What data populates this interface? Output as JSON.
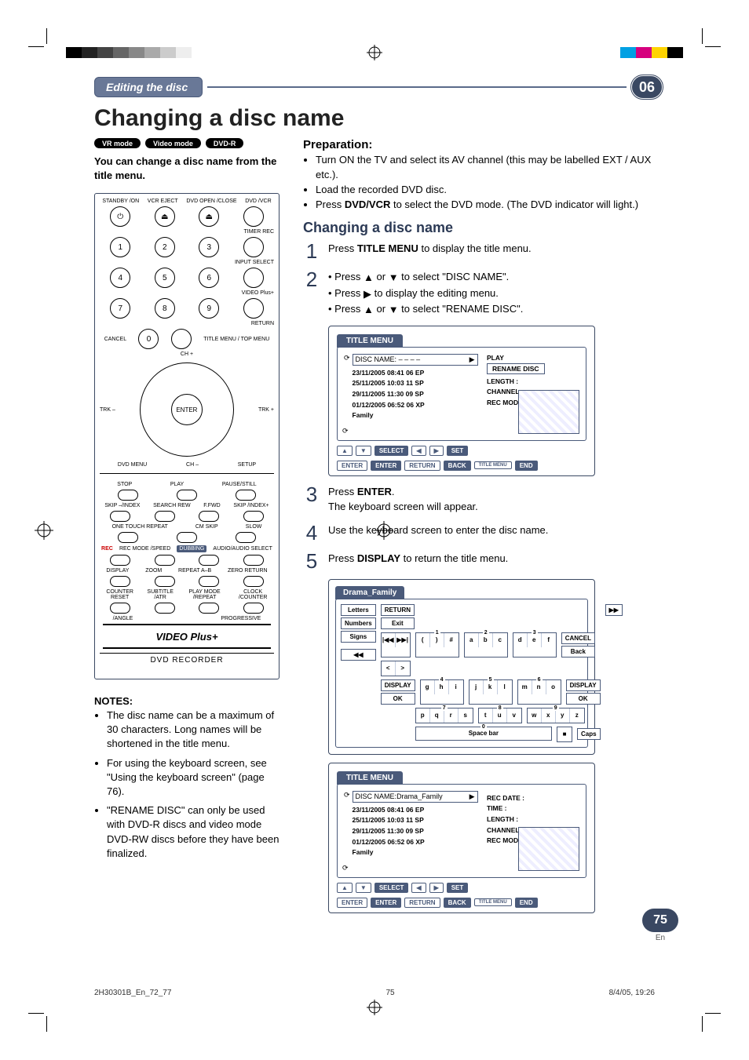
{
  "print_marks": {
    "footer_file": "2H30301B_En_72_77",
    "footer_page": "75",
    "footer_date": "8/4/05, 19:26"
  },
  "header": {
    "section": "Editing the disc",
    "chapter": "06"
  },
  "title": "Changing a disc name",
  "pills": [
    "VR mode",
    "Video mode",
    "DVD-R"
  ],
  "intro": "You can change a disc name from the title menu.",
  "remote": {
    "standby": "STANDBY\n/ON",
    "vcr_eject": "VCR\nEJECT",
    "dvd_open": "DVD\nOPEN\n/CLOSE",
    "dvd_vcr": "DVD\n/VCR",
    "timer_rec": "TIMER REC",
    "input_select": "INPUT SELECT",
    "video_plus": "VIDEO Plus+",
    "return": "RETURN",
    "cancel": "CANCEL",
    "title_menu": "TITLE MENU\n/ TOP MENU",
    "ch_plus": "CH +",
    "ch_minus": "CH –",
    "trk_minus": "TRK\n–",
    "trk_plus": "TRK\n+",
    "enter": "ENTER",
    "dvd_menu": "DVD\nMENU",
    "setup": "SETUP",
    "stop": "STOP",
    "play": "PLAY",
    "pause": "PAUSE/STILL",
    "skip_minus": "SKIP\n–/INDEX",
    "search_rew": "SEARCH REW",
    "search_fwd": "F.FWD",
    "skip_plus": "SKIP\n/INDEX+",
    "one_touch": "ONE TOUCH\nREPEAT",
    "cm_skip": "CM SKIP",
    "slow": "SLOW",
    "rec": "REC",
    "rec_mode": "REC MODE\n/SPEED",
    "dubbing": "DUBBING",
    "audio_sel": "AUDIO/AUDIO\nSELECT",
    "display": "DISPLAY",
    "zoom": "ZOOM",
    "repeat_ab": "REPEAT A–B",
    "zero_return": "ZERO RETURN",
    "counter_reset": "COUNTER\nRESET",
    "subtitle": "SUBTITLE\n/ATR",
    "play_mode": "PLAY MODE\n/REPEAT",
    "clock": "CLOCK\n/COUNTER",
    "angle": "/ANGLE",
    "progressive": "PROGRESSIVE",
    "brand": "VIDEO Plus+",
    "device": "DVD RECORDER"
  },
  "notes_heading": "NOTES:",
  "notes": [
    "The disc name can be a maximum of 30 characters. Long names will be shortened in the title menu.",
    "For using the keyboard screen, see \"Using the keyboard screen\" (page 76).",
    "\"RENAME DISC\" can only be used with DVD-R discs and video mode DVD-RW discs before they have been finalized."
  ],
  "prep_heading": "Preparation:",
  "prep": {
    "p1": "Turn ON the TV and select its AV channel (this may be labelled EXT / AUX etc.).",
    "p2": "Load the recorded DVD disc.",
    "p3a": "Press ",
    "p3b": "DVD/VCR",
    "p3c": " to select the DVD mode. (The DVD indicator will light.)"
  },
  "section_heading": "Changing a disc name",
  "steps": {
    "s1a": "Press ",
    "s1b": "TITLE MENU",
    "s1c": " to display the title menu.",
    "s2l1a": "Press ",
    "s2l1b": " or ",
    "s2l1c": " to select \"DISC NAME\".",
    "s2l2a": "Press ",
    "s2l2b": " to display the editing menu.",
    "s2l3a": "Press ",
    "s2l3b": " or ",
    "s2l3c": " to select \"RENAME DISC\".",
    "s3a": "Press ",
    "s3b": "ENTER",
    "s3c": ".",
    "s3d": "The keyboard screen will appear.",
    "s4": "Use the keyboard screen to enter the disc name.",
    "s5a": "Press ",
    "s5b": "DISPLAY",
    "s5c": " to return the title menu."
  },
  "osd1": {
    "title": "TITLE MENU",
    "disc_name_label": "DISC NAME:",
    "disc_name_value": "– – – –",
    "entries": [
      "23/11/2005 08:41 06 EP",
      "25/11/2005 10:03 11 SP",
      "29/11/2005 11:30 09 SP",
      "01/12/2005 06:52 06 XP",
      "Family"
    ],
    "right_play": "PLAY",
    "rename": "RENAME DISC",
    "meta": [
      "LENGTH    :",
      "CHANNEL  :",
      "REC MODE :"
    ],
    "footer": [
      "SELECT",
      "SET",
      "ENTER",
      "ENTER",
      "RETURN",
      "BACK",
      "TITLE MENU",
      "END"
    ]
  },
  "kbd": {
    "title": "Drama_Family",
    "side": [
      "Letters",
      "Numbers",
      "Signs"
    ],
    "side2": [
      "RETURN",
      "Exit"
    ],
    "skip": [
      "|◀◀",
      "▶▶|"
    ],
    "nav": [
      "<",
      ">"
    ],
    "display": "DISPLAY",
    "ok": "OK",
    "rewff": [
      "◀◀",
      "▶▶"
    ],
    "groups": [
      {
        "n": "1",
        "cells": [
          "(",
          ")",
          "#"
        ]
      },
      {
        "n": "2",
        "cells": [
          "a",
          "b",
          "c"
        ]
      },
      {
        "n": "3",
        "cells": [
          "d",
          "e",
          "f"
        ]
      },
      {
        "n": "4",
        "cells": [
          "g",
          "h",
          "i"
        ]
      },
      {
        "n": "5",
        "cells": [
          "j",
          "k",
          "l"
        ]
      },
      {
        "n": "6",
        "cells": [
          "m",
          "n",
          "o"
        ]
      },
      {
        "n": "7",
        "cells": [
          "p",
          "q",
          "r",
          "s"
        ]
      },
      {
        "n": "8",
        "cells": [
          "t",
          "u",
          "v"
        ]
      },
      {
        "n": "9",
        "cells": [
          "w",
          "x",
          "y",
          "z"
        ]
      },
      {
        "n": "0",
        "cells": []
      }
    ],
    "right": [
      "CANCEL",
      "Back",
      "DISPLAY",
      "OK"
    ],
    "space": "Space bar",
    "stop": "■",
    "caps": "Caps"
  },
  "osd2": {
    "title": "TITLE MENU",
    "disc_name_label": "DISC NAME:",
    "disc_name_value": "Drama_Family",
    "entries": [
      "23/11/2005 08:41 06 EP",
      "25/11/2005 10:03 11 SP",
      "29/11/2005 11:30 09 SP",
      "01/12/2005 06:52 06 XP",
      "Family"
    ],
    "meta": [
      "REC DATE  :",
      "TIME      :",
      "LENGTH    :",
      "CHANNEL   :",
      "REC MODE :"
    ],
    "footer": [
      "SELECT",
      "SET",
      "ENTER",
      "ENTER",
      "RETURN",
      "BACK",
      "TITLE MENU",
      "END"
    ]
  },
  "page_num": "75",
  "page_lang": "En"
}
